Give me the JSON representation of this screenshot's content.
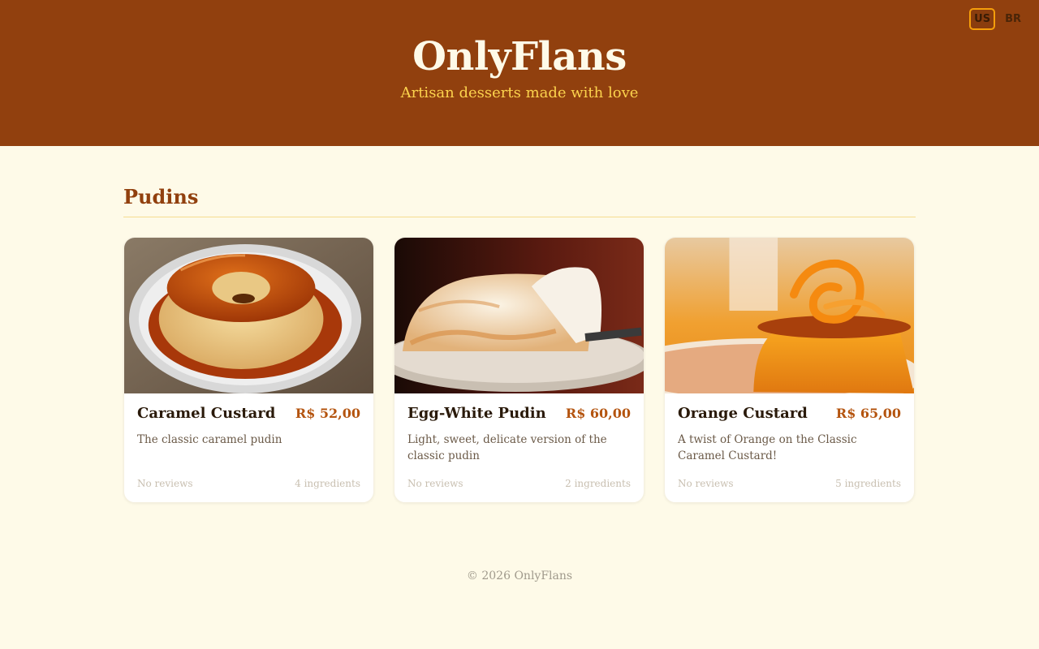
{
  "header": {
    "brand": "OnlyFlans",
    "tagline": "Artisan desserts made with love",
    "languages": [
      "US",
      "BR"
    ],
    "active_language": "US"
  },
  "section": {
    "title": "Pudins"
  },
  "products": [
    {
      "name": "Caramel Custard",
      "price": "R$ 52,00",
      "description": "The classic caramel pudin",
      "reviews": "No reviews",
      "ingredients": "4 ingredients",
      "image": "caramel-flan-photo"
    },
    {
      "name": "Egg-White Pudin",
      "price": "R$ 60,00",
      "description": "Light, sweet, delicate version of the classic pudin",
      "reviews": "No reviews",
      "ingredients": "2 ingredients",
      "image": "egg-white-pudin-photo"
    },
    {
      "name": "Orange Custard",
      "price": "R$ 65,00",
      "description": "A twist of Orange on the Classic Caramel Custard!",
      "reviews": "No reviews",
      "ingredients": "5 ingredients",
      "image": "orange-custard-photo"
    }
  ],
  "footer": {
    "copyright": "© 2026 OnlyFlans"
  },
  "colors": {
    "header_bg": "#91400e",
    "page_bg": "#fefae8",
    "accent": "#fcd34d",
    "price": "#b4540f",
    "active_lang_border": "#f59e0b"
  }
}
